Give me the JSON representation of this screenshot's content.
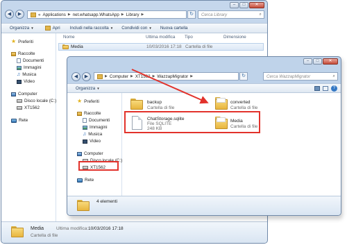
{
  "back_window": {
    "address": [
      "Applications",
      "net.whatsapp.WhatsApp",
      "Library"
    ],
    "address_prefix": "«",
    "search_placeholder": "Cerca Library",
    "toolbar": {
      "organize": "Organizza",
      "open": "Apri",
      "include": "Includi nella raccolta",
      "share": "Condividi con",
      "new_folder": "Nuova cartella"
    },
    "columns": {
      "name": "Nome",
      "modified": "Ultima modifica",
      "type": "Tipo",
      "size": "Dimensione"
    },
    "rows": [
      {
        "name": "Media",
        "modified": "10/03/2016 17:18",
        "type": "Cartella di file"
      }
    ],
    "nav": {
      "favorites": "Preferiti",
      "libraries": "Raccolte",
      "documents": "Documenti",
      "images": "Immagini",
      "music": "Musica",
      "video": "Video",
      "computer": "Computer",
      "local_disk": "Disco locale (C:)",
      "device": "XT1562",
      "network": "Rete"
    },
    "details": {
      "name": "Media",
      "modified_label": "Ultima modifica:",
      "modified": "10/03/2016 17:18",
      "type": "Cartella di file"
    }
  },
  "front_window": {
    "address": [
      "Computer",
      "XT1562",
      "WazzapMigrator"
    ],
    "search_placeholder": "Cerca WazzapMigrator",
    "toolbar": {
      "organize": "Organizza"
    },
    "nav": {
      "favorites": "Preferiti",
      "libraries": "Raccolte",
      "documents": "Documenti",
      "images": "Immagini",
      "music": "Musica",
      "video": "Video",
      "computer": "Computer",
      "local_disk": "Disco locale (C:)",
      "device": "XT1562",
      "network": "Rete"
    },
    "items": [
      {
        "name": "backup",
        "type": "Cartella di file"
      },
      {
        "name": "converted",
        "type": "Cartella di file"
      },
      {
        "name": "ChatStorage.sqlite",
        "type": "File SQLITE",
        "size": "248 KB"
      },
      {
        "name": "Media",
        "type": "Cartella di file"
      }
    ],
    "status": "4 elementi"
  },
  "colors": {
    "highlight": "#e2322b",
    "window_frame": "#c5d7ec"
  }
}
